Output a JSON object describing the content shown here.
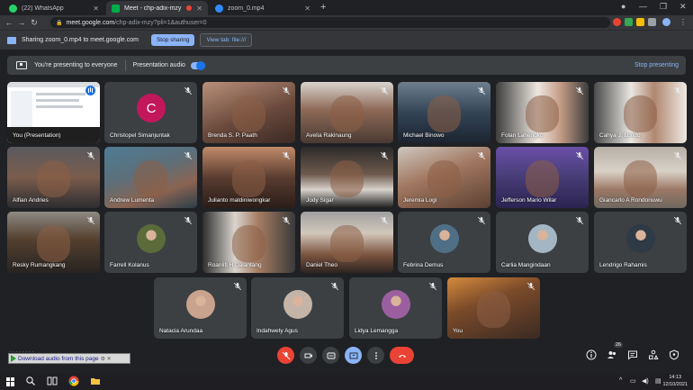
{
  "browser": {
    "tabs": [
      {
        "title": "(22) WhatsApp",
        "favicon_color": "#25d366",
        "active": false
      },
      {
        "title": "Meet - chp-adix-mzy",
        "favicon_color": "#00ac47",
        "active": true
      },
      {
        "title": "zoom_0.mp4",
        "favicon_color": "#2d8cff",
        "active": false
      }
    ],
    "new_tab_symbol": "+",
    "url_host": "meet.google.com",
    "url_path": "/chp-adix-mzy?pli=1&authuser=0"
  },
  "share_bar": {
    "message": "Sharing zoom_0.mp4 to meet.google.com",
    "stop_button": "Stop sharing",
    "view_tab_button": "View tab: file:///"
  },
  "presenting_bar": {
    "message": "You're presenting to everyone",
    "audio_label": "Presentation audio",
    "audio_on": true,
    "stop_link": "Stop presenting"
  },
  "participants": [
    {
      "name": "You (Presentation)",
      "kind": "screen"
    },
    {
      "name": "Christopel Simanjuntak",
      "kind": "letter",
      "letter": "C"
    },
    {
      "name": "Brenda S. P. Paath",
      "kind": "video"
    },
    {
      "name": "Avelia Rakinaung",
      "kind": "video"
    },
    {
      "name": "Michael Binowo",
      "kind": "video"
    },
    {
      "name": "Folan Lahengko",
      "kind": "video"
    },
    {
      "name": "Cahya J. Londo",
      "kind": "video"
    },
    {
      "name": "Alfian Andries",
      "kind": "video"
    },
    {
      "name": "Andrew Lumenta",
      "kind": "video"
    },
    {
      "name": "Julianto maldiniwongkar",
      "kind": "video"
    },
    {
      "name": "Jody Sigar",
      "kind": "video"
    },
    {
      "name": "Jeremia Logi",
      "kind": "video"
    },
    {
      "name": "Jefferson Mario Wilar",
      "kind": "video"
    },
    {
      "name": "Giancarlo A Rondonuwu",
      "kind": "video"
    },
    {
      "name": "Resky Rumangkang",
      "kind": "video"
    },
    {
      "name": "Farrell Kolanus",
      "kind": "avatar"
    },
    {
      "name": "Roanlifi H Dalantang",
      "kind": "video"
    },
    {
      "name": "Daniel Theo",
      "kind": "video"
    },
    {
      "name": "Febrina Demus",
      "kind": "avatar"
    },
    {
      "name": "Carlia Mangindaan",
      "kind": "avatar"
    },
    {
      "name": "Lendrigo Rahamis",
      "kind": "avatar"
    },
    {
      "name": "Natacia Arundaa",
      "kind": "avatar"
    },
    {
      "name": "Indahwety Agus",
      "kind": "avatar"
    },
    {
      "name": "Lidya Lemangga",
      "kind": "avatar"
    },
    {
      "name": "You",
      "kind": "video"
    }
  ],
  "controls": {
    "participant_count": "26",
    "download_bar": "Download audio from this page"
  },
  "taskbar": {
    "time": "14:13",
    "date": "12/10/2021"
  },
  "colors": {
    "meet_bg": "#202124",
    "tile_bg": "#3c4043",
    "accent_blue": "#8ab4f8",
    "end_call_red": "#ea4335"
  }
}
